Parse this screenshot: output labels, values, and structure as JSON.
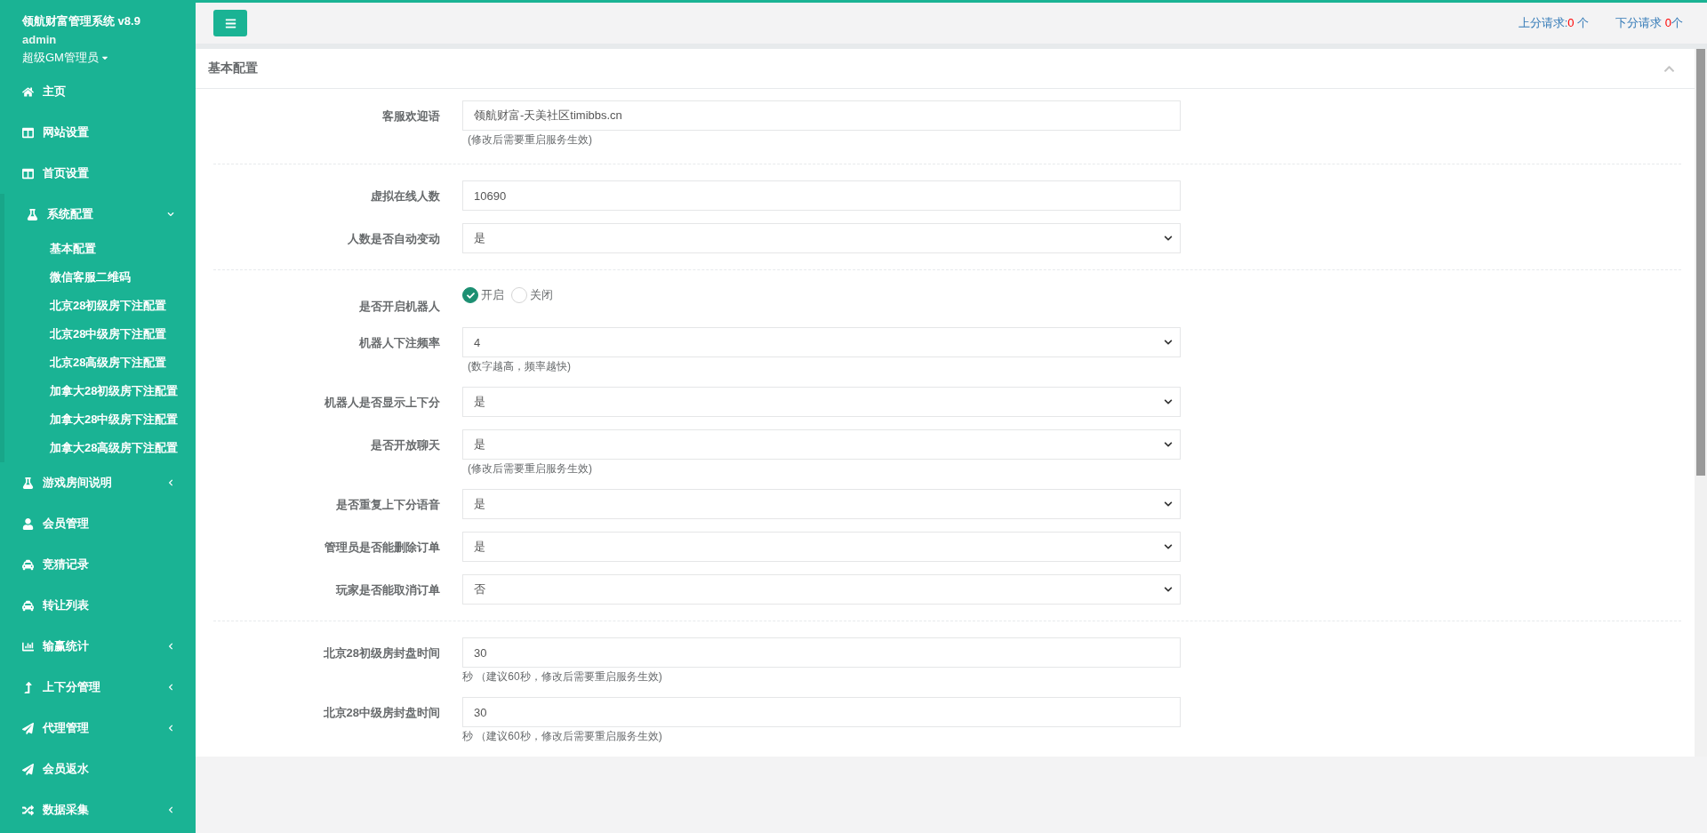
{
  "sidebar": {
    "title": "领航财富管理系统 v8.9",
    "user": "admin",
    "role": "超级GM管理员",
    "items": [
      {
        "label": "主页",
        "kind": "link"
      },
      {
        "label": "网站设置",
        "kind": "link"
      },
      {
        "label": "首页设置",
        "kind": "link"
      },
      {
        "label": "系统配置",
        "kind": "group",
        "expanded": true,
        "children": [
          {
            "label": "基本配置"
          },
          {
            "label": "微信客服二维码"
          },
          {
            "label": "北京28初级房下注配置"
          },
          {
            "label": "北京28中级房下注配置"
          },
          {
            "label": "北京28高级房下注配置"
          },
          {
            "label": "加拿大28初级房下注配置"
          },
          {
            "label": "加拿大28中级房下注配置"
          },
          {
            "label": "加拿大28高级房下注配置"
          }
        ]
      },
      {
        "label": "游戏房间说明",
        "kind": "group",
        "expanded": false
      },
      {
        "label": "会员管理",
        "kind": "link"
      },
      {
        "label": "竞猜记录",
        "kind": "link"
      },
      {
        "label": "转让列表",
        "kind": "link"
      },
      {
        "label": "输赢统计",
        "kind": "group",
        "expanded": false
      },
      {
        "label": "上下分管理",
        "kind": "group",
        "expanded": false
      },
      {
        "label": "代理管理",
        "kind": "group",
        "expanded": false
      },
      {
        "label": "会员返水",
        "kind": "link"
      },
      {
        "label": "数据采集",
        "kind": "group",
        "expanded": false
      }
    ]
  },
  "header": {
    "requests": [
      {
        "label": "上分请求:",
        "count": "0",
        "unit": " 个"
      },
      {
        "label": "下分请求 ",
        "count": "0",
        "unit": "个"
      }
    ]
  },
  "panel": {
    "title": "基本配置",
    "sections": [
      [
        {
          "label": "客服欢迎语",
          "kind": "text",
          "value": "领航财富-天美社区timibbs.cn",
          "hint": "(修改后需要重启服务生效)"
        }
      ],
      [
        {
          "label": "虚拟在线人数",
          "kind": "text",
          "value": "10690"
        },
        {
          "label": "人数是否自动变动",
          "kind": "select",
          "value": "是"
        }
      ],
      [
        {
          "label": "是否开启机器人",
          "kind": "radio",
          "options": [
            {
              "label": "开启",
              "selected": true
            },
            {
              "label": "关闭",
              "selected": false
            }
          ]
        },
        {
          "label": "机器人下注频率",
          "kind": "select",
          "value": "4",
          "hint": "(数字越高，频率越快)"
        },
        {
          "label": "机器人是否显示上下分",
          "kind": "select",
          "value": "是"
        },
        {
          "label": "是否开放聊天",
          "kind": "select",
          "value": "是",
          "hint": "(修改后需要重启服务生效)"
        },
        {
          "label": "是否重复上下分语音",
          "kind": "select",
          "value": "是"
        },
        {
          "label": "管理员是否能删除订单",
          "kind": "select",
          "value": "是"
        },
        {
          "label": "玩家是否能取消订单",
          "kind": "select",
          "value": "否"
        }
      ],
      [
        {
          "label": "北京28初级房封盘时间",
          "kind": "text",
          "value": "30",
          "hint": "秒 （建议60秒，修改后需要重启服务生效)"
        },
        {
          "label": "北京28中级房封盘时间",
          "kind": "text",
          "value": "30",
          "hint": "秒 （建议60秒，修改后需要重启服务生效)"
        }
      ]
    ]
  }
}
